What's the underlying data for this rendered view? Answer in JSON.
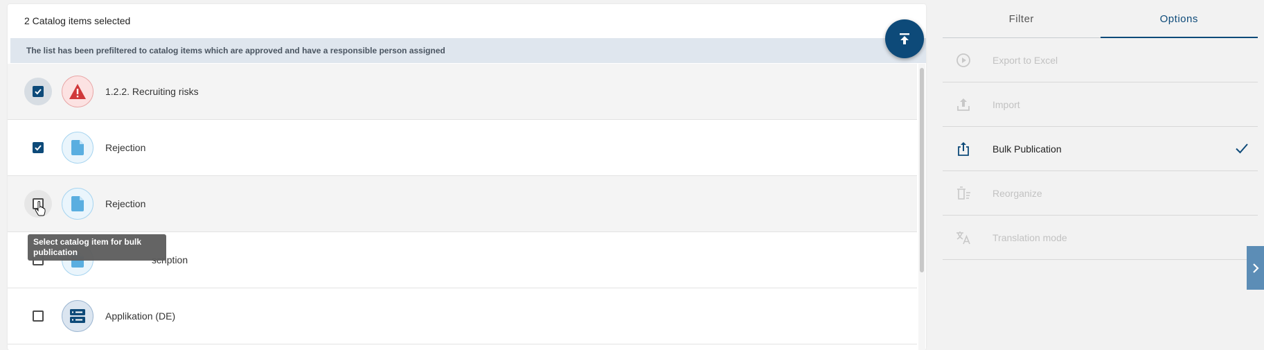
{
  "header": {
    "selection_text": "2 Catalog items selected"
  },
  "banner": {
    "text": "The list has been prefiltered to catalog items which are approved and have a responsible person assigned"
  },
  "fab": {
    "icon": "scroll-to-top-icon"
  },
  "items": [
    {
      "label": "1.2.2. Recruiting risks",
      "checked": true,
      "icon": "risk-warning-icon"
    },
    {
      "label": "Rejection",
      "checked": true,
      "icon": "document-icon"
    },
    {
      "label": "Rejection",
      "checked": false,
      "icon": "document-icon"
    },
    {
      "label": "scription",
      "checked": false,
      "icon": "document-icon"
    },
    {
      "label": "Applikation (DE)",
      "checked": false,
      "icon": "application-server-icon"
    }
  ],
  "tooltip": {
    "text": "Select catalog item for bulk publication"
  },
  "sidebar": {
    "tabs": [
      {
        "label": "Filter",
        "active": false
      },
      {
        "label": "Options",
        "active": true
      }
    ],
    "options": [
      {
        "label": "Export to Excel",
        "icon": "play-circle-icon",
        "enabled": false
      },
      {
        "label": "Import",
        "icon": "upload-icon",
        "enabled": false
      },
      {
        "label": "Bulk Publication",
        "icon": "share-icon",
        "enabled": true,
        "selected": true
      },
      {
        "label": "Reorganize",
        "icon": "reorganize-icon",
        "enabled": false
      },
      {
        "label": "Translation mode",
        "icon": "translate-icon",
        "enabled": false
      }
    ]
  },
  "colors": {
    "accent": "#0d4a79",
    "banner_bg": "#dfe6ee",
    "risk_red": "#d0383a",
    "doc_blue": "#5aaee0",
    "expand_button": "#5c8db6"
  }
}
